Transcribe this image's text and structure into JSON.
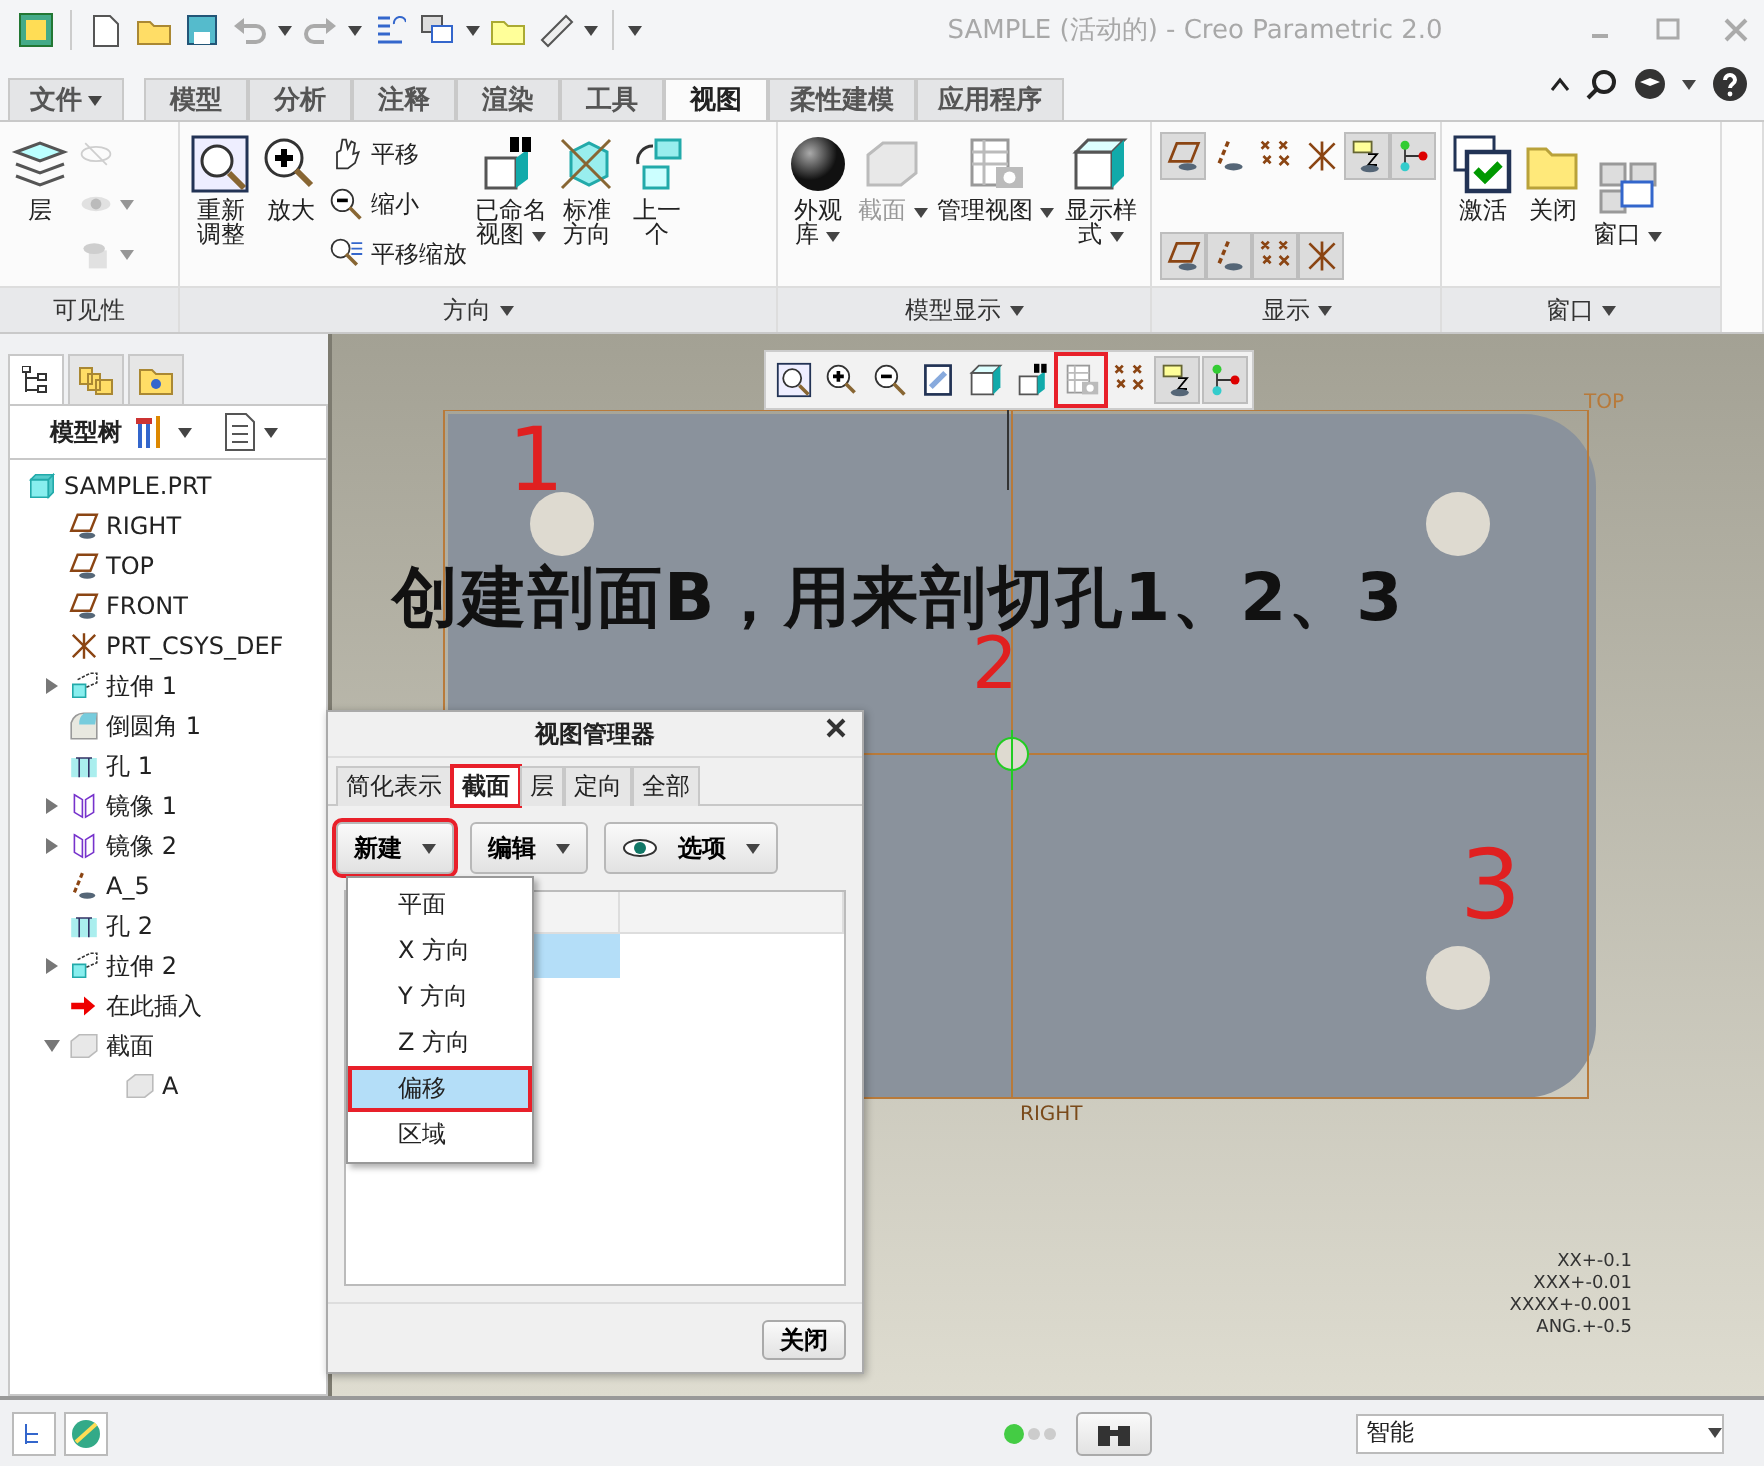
{
  "window": {
    "title": "SAMPLE (活动的) - Creo Parametric 2.0"
  },
  "ribbon_tabs": [
    {
      "label": "文件",
      "selected": false,
      "kind": "menu"
    },
    {
      "label": "模型",
      "selected": false,
      "kind": "tab"
    },
    {
      "label": "分析",
      "selected": false,
      "kind": "tab"
    },
    {
      "label": "注释",
      "selected": false,
      "kind": "tab"
    },
    {
      "label": "渲染",
      "selected": false,
      "kind": "tab"
    },
    {
      "label": "工具",
      "selected": false,
      "kind": "tab"
    },
    {
      "label": "视图",
      "selected": true,
      "kind": "tab"
    },
    {
      "label": "柔性建模",
      "selected": false,
      "kind": "tab"
    },
    {
      "label": "应用程序",
      "selected": false,
      "kind": "tab"
    }
  ],
  "ribbon_groups": [
    {
      "label": "可见性",
      "menu": false,
      "kind": "columns",
      "columns": [
        [
          {
            "kind": "layers",
            "lines": [
              "层"
            ],
            "dropdown": false,
            "disabled": false
          }
        ],
        [
          {
            "kind": "eye-off",
            "dropdown": false,
            "disabled": true
          },
          {
            "kind": "eye",
            "dropdown": true,
            "disabled": true
          },
          {
            "kind": "eye-disk",
            "dropdown": true,
            "disabled": true
          }
        ]
      ]
    },
    {
      "label": "方向",
      "menu": true,
      "kind": "columns",
      "columns": [
        [
          {
            "kind": "refit",
            "lines": [
              "重新",
              "调整"
            ],
            "dropdown": false,
            "disabled": false
          }
        ],
        [
          {
            "kind": "zoom-in",
            "lines": [
              "放大"
            ],
            "dropdown": false,
            "disabled": false
          }
        ],
        [
          {
            "kind": "pan",
            "lines": [
              "平移"
            ],
            "dropdown": false,
            "disabled": false
          },
          {
            "kind": "zoom-out",
            "lines": [
              "缩小"
            ],
            "dropdown": false,
            "disabled": false
          },
          {
            "kind": "pan-zoom",
            "lines": [
              "平移缩放"
            ],
            "dropdown": false,
            "disabled": false
          }
        ],
        [
          {
            "kind": "named-view",
            "lines": [
              "已命名",
              "视图"
            ],
            "dropdown": true,
            "disabled": false
          }
        ],
        [
          {
            "kind": "standard",
            "lines": [
              "标准",
              "方向"
            ],
            "dropdown": false,
            "disabled": false
          }
        ],
        [
          {
            "kind": "previous",
            "lines": [
              "上一",
              "个"
            ],
            "dropdown": false,
            "disabled": false
          }
        ]
      ]
    },
    {
      "label": "模型显示",
      "menu": true,
      "kind": "columns",
      "columns": [
        [
          {
            "kind": "sphere",
            "lines": [
              "外观",
              "库"
            ],
            "dropdown": true,
            "disabled": false
          }
        ],
        [
          {
            "kind": "section",
            "lines": [
              "截面"
            ],
            "dropdown": true,
            "disabled": true
          }
        ],
        [
          {
            "kind": "manage",
            "lines": [
              "管理视图"
            ],
            "dropdown": true,
            "disabled": false
          }
        ],
        [
          {
            "kind": "cube",
            "lines": [
              "显示样",
              "式"
            ],
            "dropdown": true,
            "disabled": false
          }
        ]
      ]
    },
    {
      "label": "显示",
      "menu": true,
      "kind": "grid",
      "rows": [
        [
          {
            "kind": "plane",
            "pressed": true
          },
          {
            "kind": "axis",
            "pressed": false
          },
          {
            "kind": "points",
            "pressed": false
          },
          {
            "kind": "csys",
            "pressed": false
          },
          {
            "kind": "tag",
            "pressed": true
          },
          {
            "kind": "nodes",
            "pressed": true
          }
        ],
        [
          {
            "kind": "plane",
            "pressed": true
          },
          {
            "kind": "axis",
            "pressed": true
          },
          {
            "kind": "points",
            "pressed": true
          },
          {
            "kind": "csys",
            "pressed": true
          }
        ]
      ]
    },
    {
      "label": "窗口",
      "menu": true,
      "kind": "columns",
      "columns": [
        [
          {
            "kind": "activate",
            "lines": [
              "激活"
            ],
            "dropdown": false,
            "disabled": false
          }
        ],
        [
          {
            "kind": "folder",
            "lines": [
              "关闭"
            ],
            "dropdown": false,
            "disabled": false
          }
        ],
        [
          {
            "kind": "windows",
            "lines": [
              "窗口"
            ],
            "dropdown": true,
            "disabled": false
          }
        ]
      ]
    }
  ],
  "model_tree": {
    "title": "模型树",
    "items": [
      {
        "label": "SAMPLE.PRT",
        "kind": "part",
        "children": [
          {
            "label": "RIGHT",
            "kind": "plane"
          },
          {
            "label": "TOP",
            "kind": "plane"
          },
          {
            "label": "FRONT",
            "kind": "plane"
          },
          {
            "label": "PRT_CSYS_DEF",
            "kind": "csys"
          },
          {
            "label": "拉伸 1",
            "kind": "extrude",
            "expanded": false
          },
          {
            "label": "倒圆角 1",
            "kind": "round"
          },
          {
            "label": "孔 1",
            "kind": "hole"
          },
          {
            "label": "镜像 1",
            "kind": "mirror",
            "expanded": false
          },
          {
            "label": "镜像 2",
            "kind": "mirror",
            "expanded": false
          },
          {
            "label": "A_5",
            "kind": "axis"
          },
          {
            "label": "孔 2",
            "kind": "hole"
          },
          {
            "label": "拉伸 2",
            "kind": "extrude",
            "expanded": false
          },
          {
            "label": "在此插入",
            "kind": "insert"
          },
          {
            "label": "截面",
            "kind": "section",
            "expanded": true,
            "children": [
              {
                "label": "A",
                "kind": "section"
              }
            ]
          }
        ]
      }
    ]
  },
  "graphics_toolbar": [
    {
      "kind": "refit",
      "pressed": false,
      "highlighted": false
    },
    {
      "kind": "zoom-in",
      "pressed": false,
      "highlighted": false
    },
    {
      "kind": "zoom-out",
      "pressed": false,
      "highlighted": false
    },
    {
      "kind": "repaint",
      "pressed": false,
      "highlighted": false
    },
    {
      "kind": "cube",
      "pressed": false,
      "highlighted": false
    },
    {
      "kind": "named-view",
      "pressed": false,
      "highlighted": false
    },
    {
      "kind": "manage",
      "pressed": false,
      "highlighted": true
    },
    {
      "kind": "points",
      "pressed": false,
      "highlighted": false
    },
    {
      "kind": "tag",
      "pressed": true,
      "highlighted": false
    },
    {
      "kind": "nodes",
      "pressed": true,
      "highlighted": false
    }
  ],
  "canvas": {
    "datum_labels": [
      "TOP",
      "RIGHT"
    ],
    "callouts": [
      "1",
      "2",
      "3"
    ],
    "caption": "创建剖面B，用来剖切孔1、2、3",
    "tolerances": [
      "XX+-0.1",
      "XXX+-0.01",
      "XXXX+-0.001",
      "ANG.+-0.5"
    ]
  },
  "view_manager": {
    "title": "视图管理器",
    "tabs": [
      {
        "label": "简化表示",
        "selected": false,
        "highlighted": false
      },
      {
        "label": "截面",
        "selected": true,
        "highlighted": true
      },
      {
        "label": "层",
        "selected": false,
        "highlighted": false
      },
      {
        "label": "定向",
        "selected": false,
        "highlighted": false
      },
      {
        "label": "全部",
        "selected": false,
        "highlighted": false
      }
    ],
    "buttons": [
      {
        "label": "新建",
        "kind": "plain",
        "highlighted": true
      },
      {
        "label": "编辑",
        "kind": "plain",
        "highlighted": false
      },
      {
        "label": "选项",
        "kind": "eye",
        "highlighted": false
      }
    ],
    "list_rows": [
      {
        "selected": true
      }
    ],
    "menu": [
      {
        "label": "平面",
        "selected": false,
        "highlighted": false
      },
      {
        "label": "X 方向",
        "selected": false,
        "highlighted": false
      },
      {
        "label": "Y 方向",
        "selected": false,
        "highlighted": false
      },
      {
        "label": "Z 方向",
        "selected": false,
        "highlighted": false
      },
      {
        "label": "偏移",
        "selected": true,
        "highlighted": true
      },
      {
        "label": "区域",
        "selected": false,
        "highlighted": false
      }
    ],
    "close": "关闭"
  },
  "status_bar": {
    "lights": [
      {
        "color": "#44cc44"
      },
      {
        "color": "#cccccc"
      },
      {
        "color": "#cccccc"
      }
    ],
    "filter": "智能"
  }
}
